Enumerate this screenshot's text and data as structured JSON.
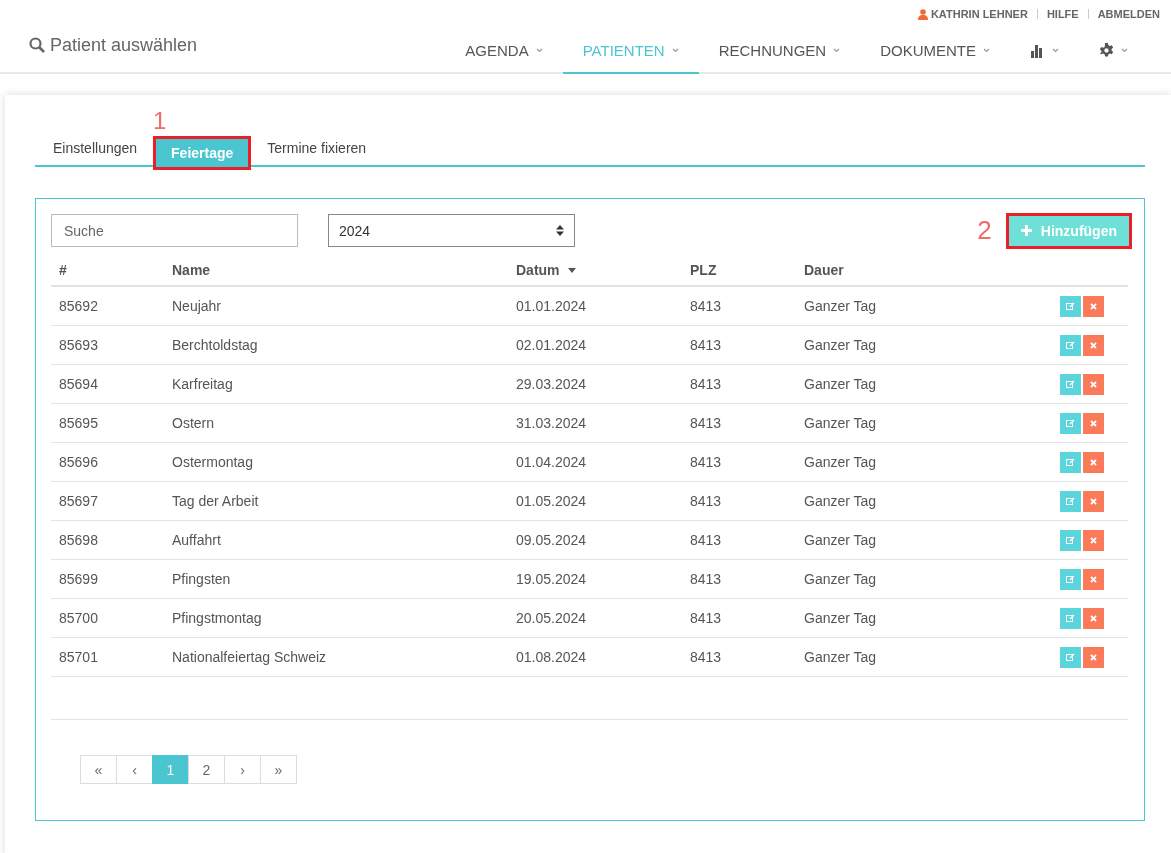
{
  "user_bar": {
    "user": "KATHRIN LEHNER",
    "links": [
      "HILFE",
      "ABMELDEN"
    ]
  },
  "patient_search": {
    "label": "Patient auswählen"
  },
  "nav": [
    {
      "kind": "text",
      "label": "AGENDA",
      "selected": false
    },
    {
      "kind": "text",
      "label": "PATIENTEN",
      "selected": true
    },
    {
      "kind": "text",
      "label": "RECHNUNGEN",
      "selected": false
    },
    {
      "kind": "text",
      "label": "DOKUMENTE",
      "selected": false
    },
    {
      "kind": "chart",
      "selected": false
    },
    {
      "kind": "gear",
      "selected": false
    }
  ],
  "tabs": [
    {
      "label": "Einstellungen",
      "selected": false
    },
    {
      "label": "Feiertage",
      "selected": true,
      "annotation": "1"
    },
    {
      "label": "Termine fixieren",
      "selected": false
    }
  ],
  "search": {
    "placeholder": "Suche"
  },
  "year_select": {
    "value": "2024"
  },
  "add_button": {
    "label": "Hinzufügen",
    "annotation": "2"
  },
  "table": {
    "columns": [
      {
        "label": "#",
        "sorted": false
      },
      {
        "label": "Name",
        "sorted": false
      },
      {
        "label": "Datum",
        "sorted": true
      },
      {
        "label": "PLZ",
        "sorted": false
      },
      {
        "label": "Dauer",
        "sorted": false
      }
    ],
    "rows": [
      [
        "85692",
        "Neujahr",
        "01.01.2024",
        "8413",
        "Ganzer Tag"
      ],
      [
        "85693",
        "Berchtoldstag",
        "02.01.2024",
        "8413",
        "Ganzer Tag"
      ],
      [
        "85694",
        "Karfreitag",
        "29.03.2024",
        "8413",
        "Ganzer Tag"
      ],
      [
        "85695",
        "Ostern",
        "31.03.2024",
        "8413",
        "Ganzer Tag"
      ],
      [
        "85696",
        "Ostermontag",
        "01.04.2024",
        "8413",
        "Ganzer Tag"
      ],
      [
        "85697",
        "Tag der Arbeit",
        "01.05.2024",
        "8413",
        "Ganzer Tag"
      ],
      [
        "85698",
        "Auffahrt",
        "09.05.2024",
        "8413",
        "Ganzer Tag"
      ],
      [
        "85699",
        "Pfingsten",
        "19.05.2024",
        "8413",
        "Ganzer Tag"
      ],
      [
        "85700",
        "Pfingstmontag",
        "20.05.2024",
        "8413",
        "Ganzer Tag"
      ],
      [
        "85701",
        "Nationalfeiertag Schweiz",
        "01.08.2024",
        "8413",
        "Ganzer Tag"
      ]
    ]
  },
  "pagination": [
    {
      "label": "«",
      "selected": false
    },
    {
      "label": "‹",
      "selected": false
    },
    {
      "label": "1",
      "selected": true
    },
    {
      "label": "2",
      "selected": false
    },
    {
      "label": "›",
      "selected": false
    },
    {
      "label": "»",
      "selected": false
    }
  ]
}
